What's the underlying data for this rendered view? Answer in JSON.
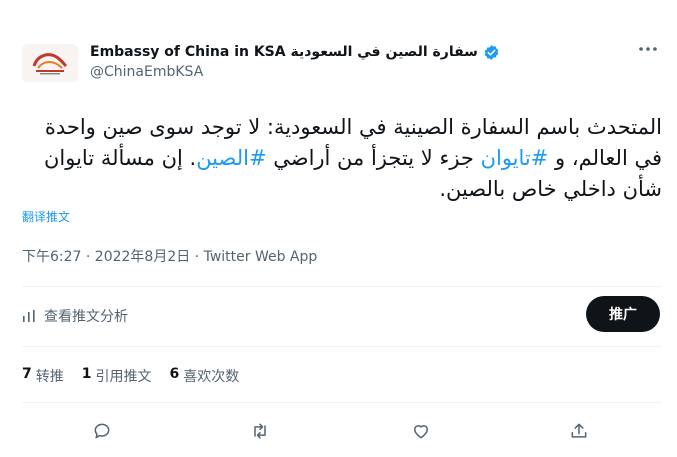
{
  "author": {
    "display_name": "Embassy of China in KSA سفارة الصين في السعودية",
    "handle": "@ChinaEmbKSA",
    "verified": true,
    "avatar_icon": "embassy-logo-icon"
  },
  "more_icon": "more-horizontal-icon",
  "tweet": {
    "text_before_1": "المتحدث باسم السفارة الصينية في السعودية: لا توجد سوى صين واحدة في العالم، و ",
    "hashtag_1": "#تايوان",
    "text_before_2": " جزء لا يتجزأ من أراضي ",
    "hashtag_2": "#الصين",
    "text_after": ". إن مسألة تايوان شأن داخلي خاص بالصين.",
    "translate_label": "翻译推文"
  },
  "meta": "下午6:27 · 2022年8月2日 · Twitter Web App",
  "analytics_label": "查看推文分析",
  "promote_label": "推广",
  "stats": {
    "retweets_num": "7",
    "retweets_label": "转推",
    "quotes_num": "1",
    "quotes_label": "引用推文",
    "likes_num": "6",
    "likes_label": "喜欢次数"
  },
  "actions": [
    "reply-icon",
    "retweet-icon",
    "like-icon",
    "share-icon"
  ],
  "colors": {
    "link": "#1d9bf0",
    "verified": "#1d9bf0",
    "muted": "#536471",
    "text": "#0f1419"
  }
}
